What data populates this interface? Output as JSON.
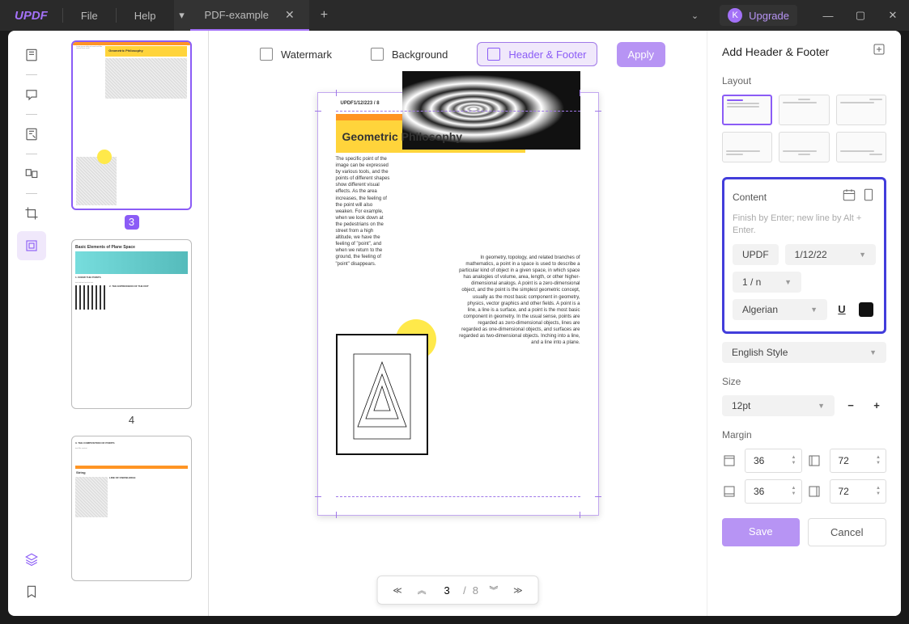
{
  "app": {
    "logo": "UPDF"
  },
  "menu": {
    "file": "File",
    "help": "Help"
  },
  "tab": {
    "title": "PDF-example"
  },
  "upgrade": {
    "avatar": "K",
    "label": "Upgrade"
  },
  "tools": {
    "watermark": "Watermark",
    "background": "Background",
    "header_footer": "Header & Footer",
    "apply": "Apply"
  },
  "thumbs": {
    "p3": "3",
    "p4": "4"
  },
  "page": {
    "hf_text": "UPDF1/12/223 / 8",
    "title": "Geometric Philosophy",
    "left_text": "The specific point of the image can be expressed by various tools, and the points of different shapes show different visual effects. As the area increases, the feeling of the point will also weaken. For example, when we look down at the pedestrians on the street from a high altitude, we have the feeling of \"point\", and when we return to the ground, the feeling of \"point\" disappears.",
    "right_text": "In geometry, topology, and related branches of mathematics, a point in a space is used to describe a particular kind of object in a given space, in which space has analogies of volume, area, length, or other higher-dimensional analogs. A point is a zero-dimensional object, and the point is the simplest geometric concept, usually as the most basic component in geometry, physics, vector graphics and other fields. A point is a line, a line is a surface, and a point is the most basic component in geometry. In the usual sense, points are regarded as zero-dimensional objects, lines are regarded as one-dimensional objects, and surfaces are regarded as two-dimensional objects. Inching into a line, and a line into a plane."
  },
  "nav": {
    "current": "3",
    "total": "8"
  },
  "panel": {
    "title": "Add Header & Footer",
    "layout_label": "Layout",
    "content_label": "Content",
    "content_hint": "Finish by Enter; new line by Alt + Enter.",
    "tag_updf": "UPDF",
    "date": "1/12/22",
    "page_fmt": "1 / n",
    "font": "Algerian",
    "style": "English Style",
    "size_label": "Size",
    "size_value": "12pt",
    "margin_label": "Margin",
    "margin_top": "36",
    "margin_bottom": "36",
    "margin_left": "72",
    "margin_right": "72",
    "save": "Save",
    "cancel": "Cancel"
  }
}
